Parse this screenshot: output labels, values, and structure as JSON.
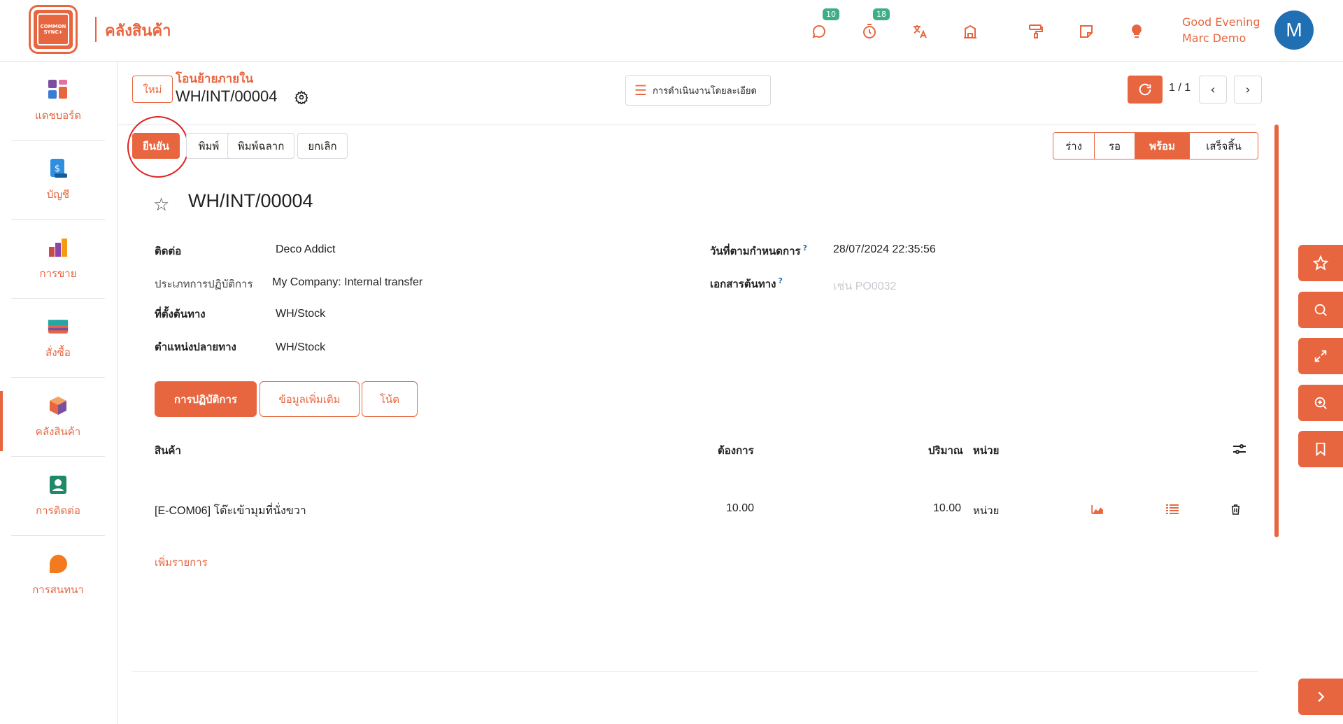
{
  "app": {
    "logo_text_1": "COMMON",
    "logo_text_2": "SYNC+",
    "title": "คลังสินค้า"
  },
  "topbar": {
    "messages_badge": "10",
    "activities_badge": "18",
    "greeting_line1": "Good Evening",
    "greeting_line2": "Marc Demo",
    "avatar_initial": "M"
  },
  "sidebar": {
    "items": [
      {
        "label": "แดชบอร์ด",
        "icon": "dashboard-icon"
      },
      {
        "label": "บัญชี",
        "icon": "accounting-icon"
      },
      {
        "label": "การขาย",
        "icon": "sales-icon"
      },
      {
        "label": "สั่งซื้อ",
        "icon": "purchase-icon"
      },
      {
        "label": "คลังสินค้า",
        "icon": "inventory-icon"
      },
      {
        "label": "การติดต่อ",
        "icon": "contacts-icon"
      },
      {
        "label": "การสนทนา",
        "icon": "discuss-icon"
      }
    ]
  },
  "control": {
    "new_label": "ใหม่",
    "breadcrumb_parent": "โอนย้ายภายใน",
    "breadcrumb_current": "WH/INT/00004",
    "actions_label": "การดำเนินงานโดยละเอียด",
    "pager": "1 / 1"
  },
  "statusbar": {
    "validate": "ยืนยัน",
    "print": "พิมพ์",
    "print_labels": "พิมพ์ฉลาก",
    "cancel": "ยกเลิก",
    "stages": [
      "ร่าง",
      "รอ",
      "พร้อม",
      "เสร็จสิ้น"
    ],
    "current_stage": "พร้อม"
  },
  "form": {
    "name": "WH/INT/00004",
    "contact_label": "ติดต่อ",
    "contact_value": "Deco Addict",
    "operation_type_label": "ประเภทการปฏิบัติการ",
    "operation_type_value": "My Company: Internal transfer",
    "source_location_label": "ที่ตั้งต้นทาง",
    "source_location_value": "WH/Stock",
    "dest_location_label": "ตำแหน่งปลายทาง",
    "dest_location_value": "WH/Stock",
    "scheduled_date_label": "วันที่ตามกำหนดการ",
    "scheduled_date_value": "28/07/2024 22:35:56",
    "source_document_label": "เอกสารต้นทาง",
    "source_document_placeholder": "เช่น PO0032"
  },
  "tabs": [
    "การปฏิบัติการ",
    "ข้อมูลเพิ่มเติม",
    "โน้ต"
  ],
  "table": {
    "headers": {
      "product": "สินค้า",
      "demand": "ต้องการ",
      "quantity": "ปริมาณ",
      "uom": "หน่วย"
    },
    "rows": [
      {
        "product": "[E-COM06] โต๊ะเข้ามุมที่นั่งขวา",
        "demand": "10.00",
        "quantity": "10.00",
        "uom": "หน่วย"
      }
    ],
    "add_line": "เพิ่มรายการ"
  },
  "colors": {
    "accent": "#e8663f",
    "badge": "#3fae86",
    "avatar": "#1f6fb2"
  }
}
